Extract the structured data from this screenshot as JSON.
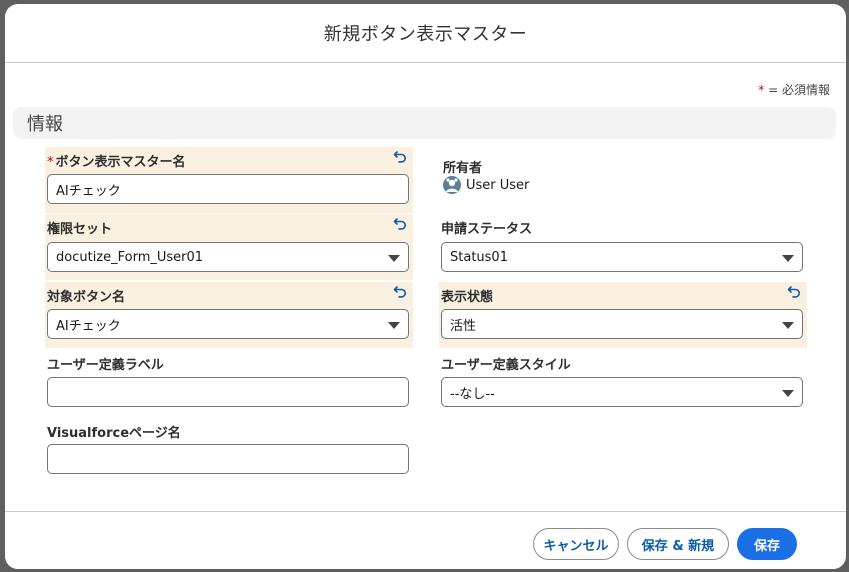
{
  "modal": {
    "title": "新規ボタン表示マスター",
    "required_legend_star": "*",
    "required_legend_text": "= 必須情報"
  },
  "section": {
    "title": "情報"
  },
  "fields": {
    "button_master_name": {
      "label": "ボタン表示マスター名",
      "required": "*",
      "value": "AIチェック"
    },
    "permission_set": {
      "label": "権限セット",
      "value": "docutize_Form_User01"
    },
    "target_button_name": {
      "label": "対象ボタン名",
      "value": "AIチェック"
    },
    "user_label": {
      "label": "ユーザー定義ラベル",
      "value": ""
    },
    "visualforce_page": {
      "label": "Visualforceページ名",
      "value": ""
    },
    "owner": {
      "label": "所有者",
      "value": "User User",
      "avatar_icon": "user-avatar-icon"
    },
    "application_status": {
      "label": "申請ステータス",
      "value": "Status01"
    },
    "display_state": {
      "label": "表示状態",
      "value": "活性"
    },
    "user_style": {
      "label": "ユーザー定義スタイル",
      "value": "--なし--"
    }
  },
  "footer": {
    "cancel": "キャンセル",
    "save_new": "保存 & 新規",
    "save": "保存"
  },
  "colors": {
    "highlight": "#faf0e0",
    "brand": "#1b6fe6",
    "required": "#ba0517",
    "undo_icon": "#0b5cab"
  }
}
